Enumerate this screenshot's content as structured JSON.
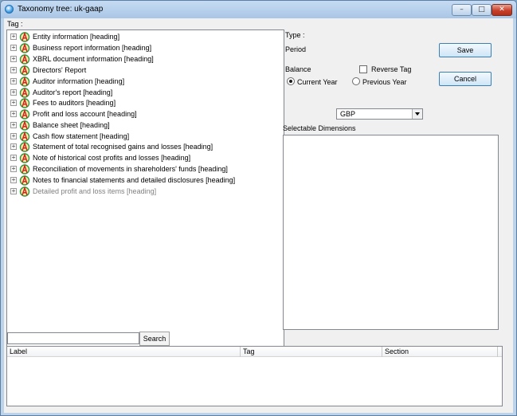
{
  "window": {
    "title": "Taxonomy tree: uk-gaap",
    "buttons": {
      "minimize": "–",
      "maximize": "□",
      "close": "✕"
    }
  },
  "tree": {
    "label": "Tag :",
    "items": [
      {
        "label": "Entity information [heading]"
      },
      {
        "label": "Business report information [heading]"
      },
      {
        "label": "XBRL document information [heading]"
      },
      {
        "label": "Directors' Report"
      },
      {
        "label": "Auditor information [heading]"
      },
      {
        "label": "Auditor's report [heading]"
      },
      {
        "label": "Fees to auditors [heading]"
      },
      {
        "label": "Profit and loss account [heading]"
      },
      {
        "label": "Balance sheet [heading]"
      },
      {
        "label": "Cash flow statement [heading]"
      },
      {
        "label": "Statement of total recognised gains and losses [heading]"
      },
      {
        "label": "Note of historical cost profits and losses [heading]"
      },
      {
        "label": "Reconciliation of movements in shareholders' funds [heading]"
      },
      {
        "label": "Notes to financial statements and detailed disclosures [heading]"
      },
      {
        "label": "Detailed profit and loss items [heading]"
      }
    ]
  },
  "details": {
    "type_label": "Type :",
    "period_label": "Period",
    "balance_label": "Balance",
    "reverse_tag_label": "Reverse Tag",
    "reverse_tag_checked": false,
    "current_year_label": "Current Year",
    "previous_year_label": "Previous Year",
    "current_year_selected": true,
    "currency_value": "GBP",
    "dimensions_label": "Selectable Dimensions"
  },
  "actions": {
    "save_label": "Save",
    "cancel_label": "Cancel"
  },
  "search": {
    "value": "",
    "button_label": "Search"
  },
  "results": {
    "columns": [
      "Label",
      "Tag",
      "Section"
    ]
  },
  "colors": {
    "accent": "#3c7fb1",
    "window_frame": "#bcd3ea",
    "close_button": "#c8402a"
  }
}
